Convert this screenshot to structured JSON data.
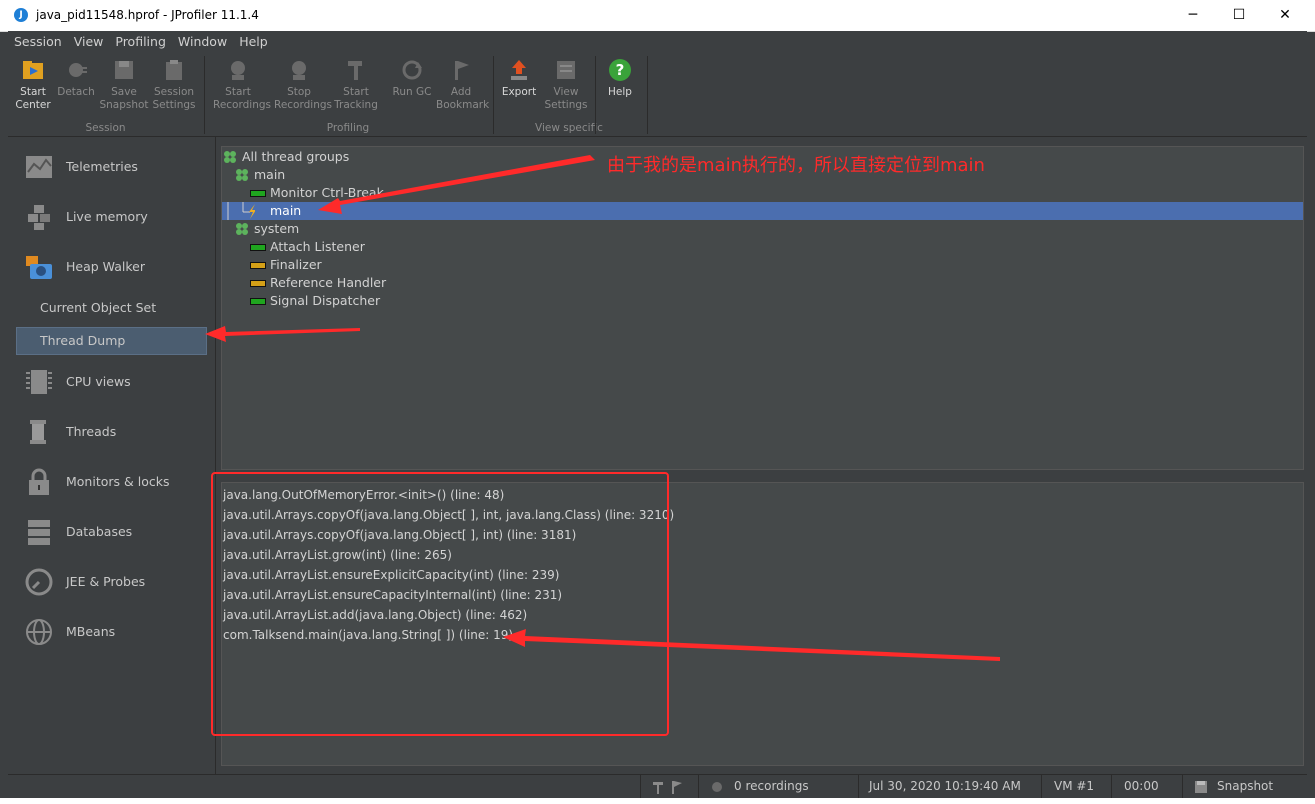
{
  "window": {
    "title": "java_pid11548.hprof - JProfiler 11.1.4",
    "minimize": "─",
    "maximize": "☐",
    "close": "✕"
  },
  "menu": [
    "Session",
    "View",
    "Profiling",
    "Window",
    "Help"
  ],
  "toolbar": {
    "start_center": [
      "Start",
      "Center"
    ],
    "detach": "Detach",
    "save_snapshot": [
      "Save",
      "Snapshot"
    ],
    "session_settings": [
      "Session",
      "Settings"
    ],
    "group_session": "Session",
    "start_recordings": [
      "Start",
      "Recordings"
    ],
    "stop_recordings": [
      "Stop",
      "Recordings"
    ],
    "start_tracking": [
      "Start",
      "Tracking"
    ],
    "run_gc": "Run GC",
    "add_bookmark": [
      "Add",
      "Bookmark"
    ],
    "group_profiling": "Profiling",
    "export": "Export",
    "view_settings": [
      "View",
      "Settings"
    ],
    "group_view_specific": "View specific",
    "help": "Help"
  },
  "sidebar": {
    "telemetries": "Telemetries",
    "live_memory": "Live memory",
    "heap_walker": "Heap Walker",
    "current_object_set": "Current Object Set",
    "thread_dump": "Thread Dump",
    "cpu_views": "CPU views",
    "threads": "Threads",
    "monitors_locks": "Monitors & locks",
    "databases": "Databases",
    "jee_probes": "JEE & Probes",
    "mbeans": "MBeans"
  },
  "tree": {
    "root": "All thread groups",
    "main_group": "main",
    "monitor_ctrl_break": "Monitor Ctrl-Break",
    "main_thread": "main",
    "system_group": "system",
    "attach_listener": "Attach Listener",
    "finalizer": "Finalizer",
    "reference_handler": "Reference Handler",
    "signal_dispatcher": "Signal Dispatcher"
  },
  "stack_trace": [
    "java.lang.OutOfMemoryError.<init>() (line: 48)",
    "java.util.Arrays.copyOf(java.lang.Object[ ], int, java.lang.Class) (line: 3210)",
    "java.util.Arrays.copyOf(java.lang.Object[ ], int) (line: 3181)",
    "java.util.ArrayList.grow(int) (line: 265)",
    "java.util.ArrayList.ensureExplicitCapacity(int) (line: 239)",
    "java.util.ArrayList.ensureCapacityInternal(int) (line: 231)",
    "java.util.ArrayList.add(java.lang.Object) (line: 462)",
    "com.Talksend.main(java.lang.String[ ]) (line: 19)"
  ],
  "annotation": {
    "text": "由于我的是main执行的，所以直接定位到main",
    "color": "#ff2a2a"
  },
  "status": {
    "recordings": "0 recordings",
    "datetime": "Jul 30, 2020 10:19:40 AM",
    "vm": "VM #1",
    "elapsed": "00:00",
    "mode": "Snapshot"
  },
  "colors": {
    "background": "#3c3f41",
    "panel": "#45494a",
    "selection": "#4b6eaf",
    "thread_running": "#1fa51f",
    "thread_waiting": "#d4a017",
    "group_icon": "#5db35d"
  }
}
